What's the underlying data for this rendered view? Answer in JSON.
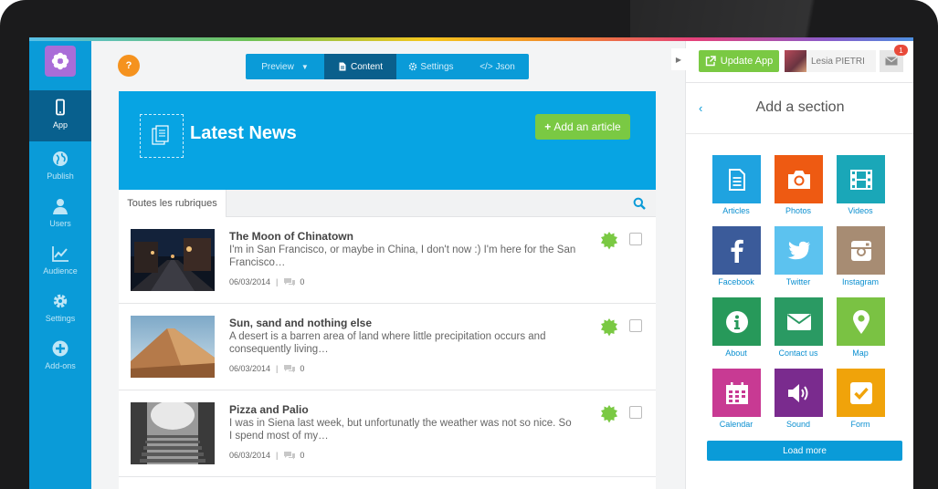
{
  "nav": {
    "items": [
      {
        "label": "App",
        "icon": "phone-icon",
        "active": true
      },
      {
        "label": "Publish",
        "icon": "globe-icon"
      },
      {
        "label": "Users",
        "icon": "user-icon"
      },
      {
        "label": "Audience",
        "icon": "chart-line-icon"
      },
      {
        "label": "Settings",
        "icon": "gear-icon"
      },
      {
        "label": "Add-ons",
        "icon": "plus-circle-icon"
      }
    ]
  },
  "toolbar": {
    "help": "?",
    "tabs": [
      {
        "label": "Preview",
        "active": false
      },
      {
        "label": "Content",
        "active": true
      },
      {
        "label": "Settings",
        "active": false
      },
      {
        "label": "Json",
        "active": false
      }
    ]
  },
  "content": {
    "header_title": "Latest News",
    "add_article": "Add an article",
    "filter_label": "Toutes les rubriques",
    "articles": [
      {
        "title": "The Moon of Chinatown",
        "excerpt": "I'm in San Francisco, or maybe in China, I don't now :) I'm here for the San Francisco…",
        "date": "06/03/2014",
        "comments": "0"
      },
      {
        "title": "Sun, sand and nothing else",
        "excerpt": "A desert is a barren area of land where little precipitation occurs and consequently living…",
        "date": "06/03/2014",
        "comments": "0"
      },
      {
        "title": "Pizza and Palio",
        "excerpt": "I was in Siena last week, but unfortunatly the weather was not so nice. So I spend most of my…",
        "date": "06/03/2014",
        "comments": "0"
      }
    ]
  },
  "panel": {
    "update_app": "Update App",
    "user_name": "Lesia PIETRI",
    "mail_badge": "1",
    "section_title": "Add a section",
    "load_more": "Load more",
    "sections": [
      {
        "label": "Articles",
        "color": "#1fa3e0",
        "icon": "article-icon"
      },
      {
        "label": "Photos",
        "color": "#ee5a12",
        "icon": "camera-icon"
      },
      {
        "label": "Videos",
        "color": "#1aa7b8",
        "icon": "film-icon"
      },
      {
        "label": "Facebook",
        "color": "#3b5b9a",
        "icon": "facebook-icon"
      },
      {
        "label": "Twitter",
        "color": "#5cc2ef",
        "icon": "twitter-icon"
      },
      {
        "label": "Instagram",
        "color": "#a78c73",
        "icon": "instagram-icon"
      },
      {
        "label": "About",
        "color": "#27995a",
        "icon": "info-icon"
      },
      {
        "label": "Contact us",
        "color": "#2a9a63",
        "icon": "envelope-icon"
      },
      {
        "label": "Map",
        "color": "#7ac243",
        "icon": "map-pin-icon"
      },
      {
        "label": "Calendar",
        "color": "#c83a93",
        "icon": "calendar-icon"
      },
      {
        "label": "Sound",
        "color": "#7a2b8e",
        "icon": "sound-icon"
      },
      {
        "label": "Form",
        "color": "#f0a30a",
        "icon": "checkbox-icon"
      }
    ]
  }
}
